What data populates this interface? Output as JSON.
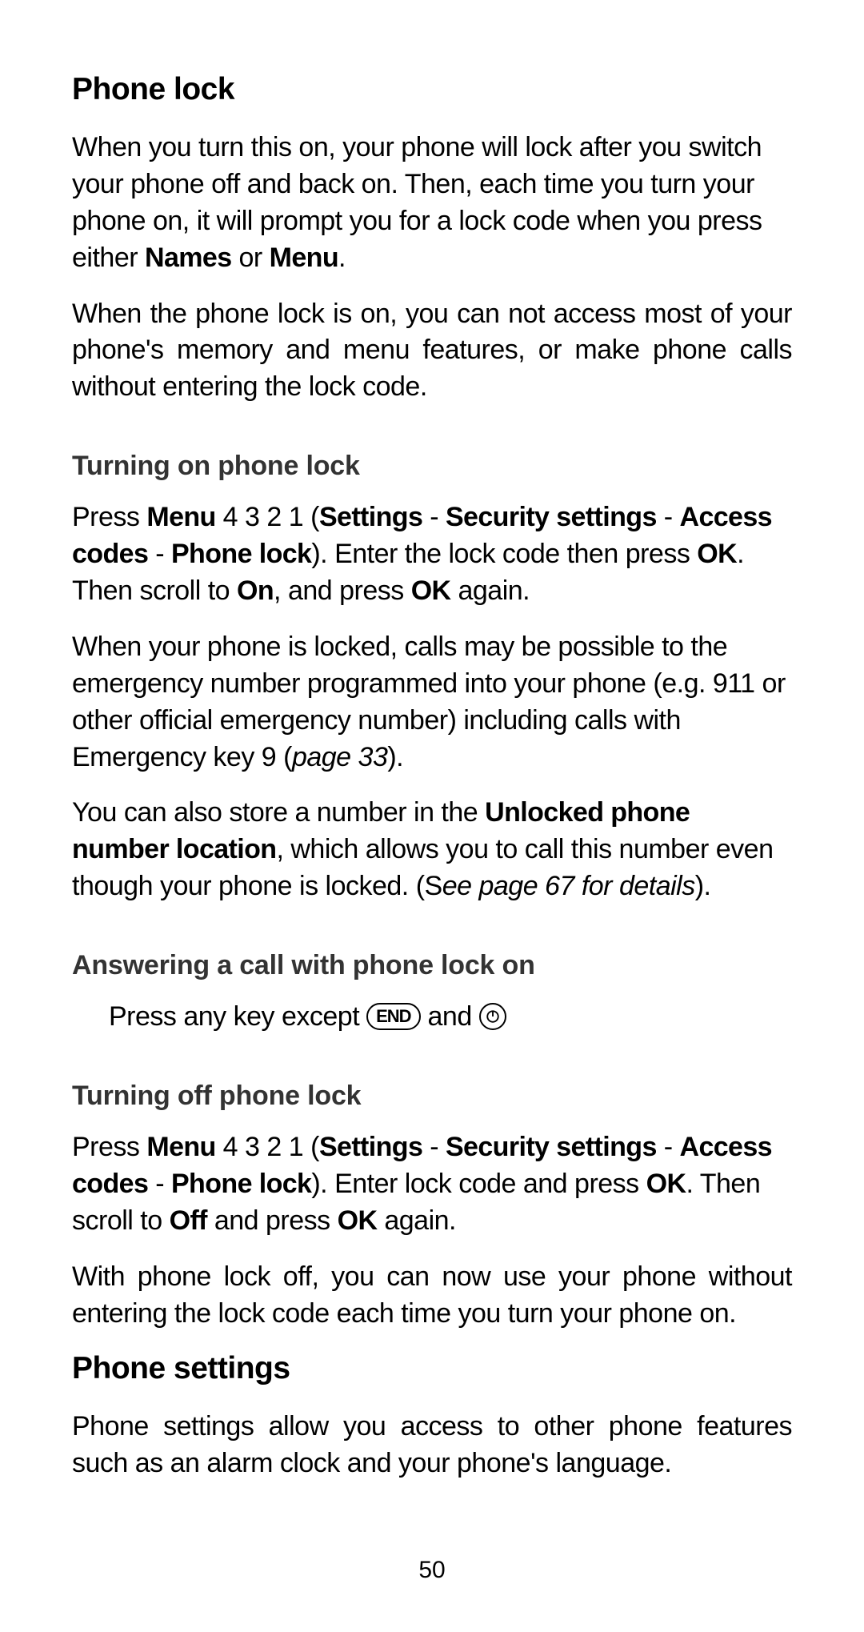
{
  "section1": {
    "heading": "Phone lock",
    "p1a": "When you turn this on, your phone will lock after you switch your phone off and back on. Then, each time you turn your phone on, it will prompt you for a lock code when you press either ",
    "p1_names": "Names",
    "p1_or": " or ",
    "p1_menu": "Menu",
    "p1b": ".",
    "p2": "When the phone lock is on, you can not access most of your phone's memory and menu features, or make phone calls without entering the lock code."
  },
  "turning_on": {
    "heading": "Turning on phone lock",
    "p1_press": "Press ",
    "p1_menu": "Menu",
    "p1_digits": " 4 3 2 1 (",
    "p1_settings": "Settings",
    "p1_dash1": " - ",
    "p1_sec": "Security settings",
    "p1_dash2": " - ",
    "p1_access": "Access codes",
    "p1_dash3": " - ",
    "p1_plock": "Phone lock",
    "p1_after": "). Enter the lock code then press ",
    "p1_ok": "OK",
    "p1_then": ". Then scroll to ",
    "p1_on": "On",
    "p1_press2": ", and press ",
    "p1_ok2": "OK",
    "p1_again": " again.",
    "p2a": "When your phone is locked, calls may be possible to the emergency number programmed into your phone (e.g. 911 or other official emergency number) including calls with Emergency key 9 (",
    "p2_page": "page 33",
    "p2b": ").",
    "p3a": "You can also store a number in the ",
    "p3_unlocked": "Unlocked phone number location",
    "p3b": ", which allows you to call this number even though your phone is locked. (S",
    "p3_see": "ee page 67 for details",
    "p3c": ")."
  },
  "answering": {
    "heading": "Answering a call with phone lock on",
    "p1a": "Press any key except ",
    "end_label": "END",
    "p1_and": " and ",
    "power_glyph": "①"
  },
  "turning_off": {
    "heading": "Turning off phone lock",
    "p1_press": "Press ",
    "p1_menu": "Menu",
    "p1_digits": " 4 3 2 1 (",
    "p1_settings": "Settings",
    "p1_dash1": " - ",
    "p1_sec": "Security settings",
    "p1_dash2": " - ",
    "p1_access": "Access codes",
    "p1_dash3": " - ",
    "p1_plock": "Phone lock",
    "p1_after": "). Enter lock code and press ",
    "p1_ok": "OK",
    "p1_then": ". Then scroll to ",
    "p1_off": "Off",
    "p1_press2": " and press ",
    "p1_ok2": "OK",
    "p1_again": " again.",
    "p2": "With phone lock off, you can now use your phone without entering the lock code each time you turn your phone on."
  },
  "section2": {
    "heading": "Phone settings",
    "p1": "Phone settings allow you access to other phone features such as an alarm clock and your phone's language."
  },
  "page_number": "50"
}
